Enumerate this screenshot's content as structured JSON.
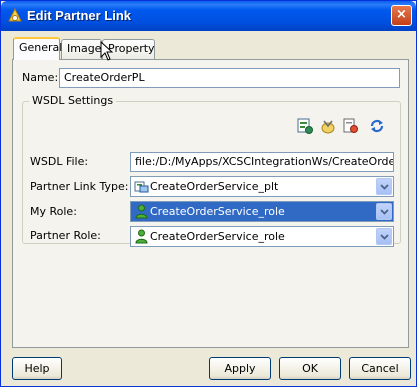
{
  "window": {
    "title": "Edit Partner Link",
    "close_glyph": "×"
  },
  "tabs": [
    {
      "label": "General",
      "active": true
    },
    {
      "label": "Image",
      "active": false
    },
    {
      "label": "Property",
      "active": false
    }
  ],
  "form": {
    "name_label": "Name:",
    "name_value": "CreateOrderPL",
    "wsdl_group_title": "WSDL Settings",
    "wsdl_file_label": "WSDL File:",
    "wsdl_file_value": "file:/D:/MyApps/XCSCIntegrationWs/CreateOrder/Cre",
    "partner_link_type_label": "Partner Link Type:",
    "partner_link_type_value": "CreateOrderService_plt",
    "my_role_label": "My Role:",
    "my_role_value": "CreateOrderService_role",
    "partner_role_label": "Partner Role:",
    "partner_role_value": "CreateOrderService_role"
  },
  "toolbar_icons": [
    "wsdl-wizard-icon",
    "browse-wsdl-icon",
    "service-explorer-icon",
    "refresh-icon"
  ],
  "buttons": {
    "help": "Help",
    "apply": "Apply",
    "ok": "OK",
    "cancel": "Cancel"
  },
  "colors": {
    "title_bar": "#0058ee",
    "selection": "#316ac5",
    "dialog_bg": "#ece9d8"
  }
}
